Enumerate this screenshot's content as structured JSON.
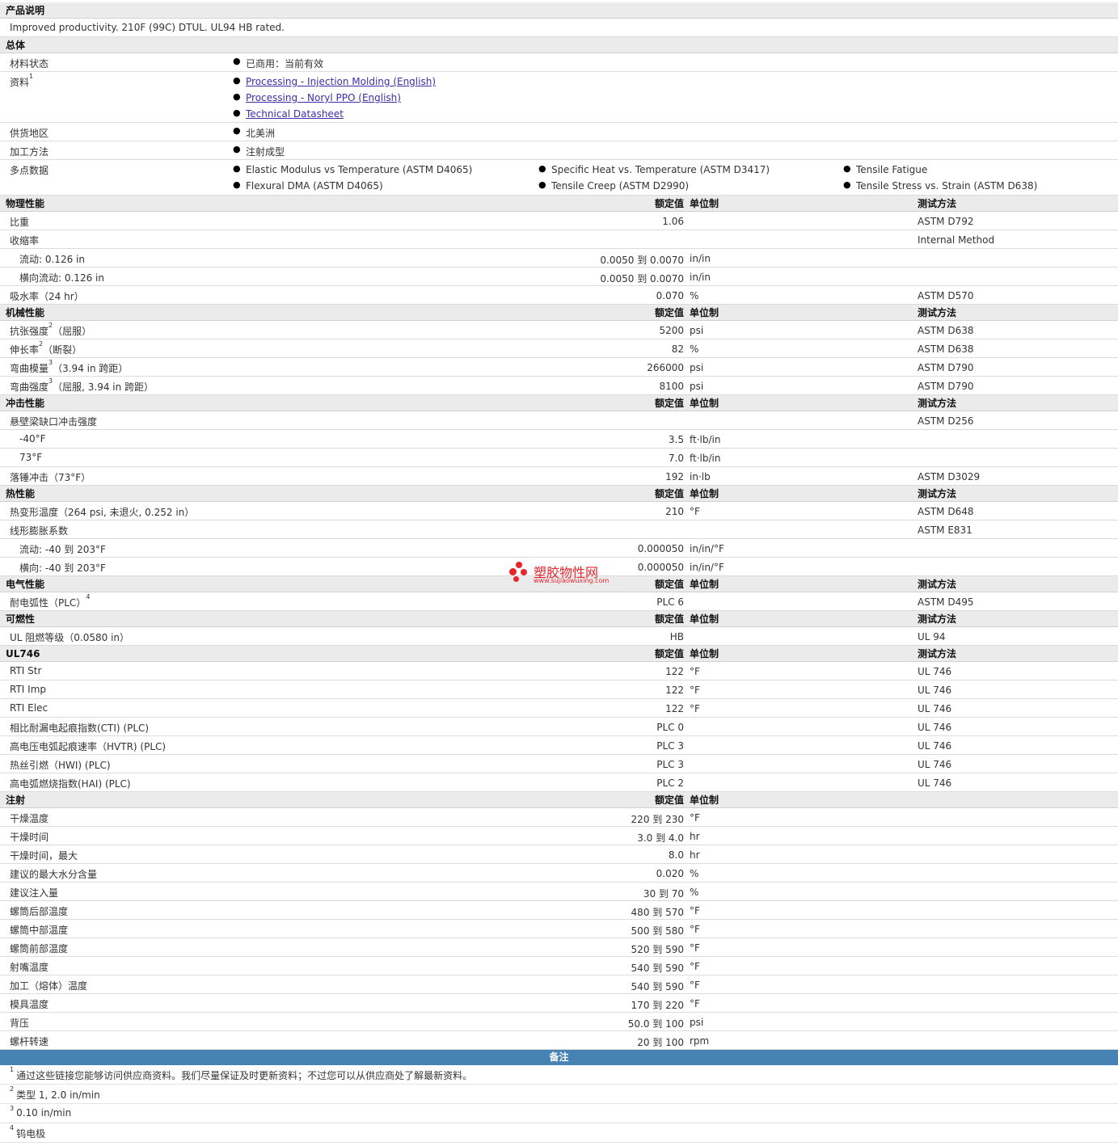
{
  "description": {
    "title": "产品说明",
    "text": "Improved productivity. 210F (99C) DTUL. UL94 HB rated."
  },
  "general": {
    "title": "总体",
    "status_label": "材料状态",
    "status_value": "已商用：当前有效",
    "docs_label": "资料",
    "docs_sup": "1",
    "docs": [
      "Processing - Injection Molding (English)",
      "Processing - Noryl PPO (English)",
      "Technical Datasheet"
    ],
    "region_label": "供货地区",
    "region_value": "北美洲",
    "method_label": "加工方法",
    "method_value": "注射成型",
    "multipoint_label": "多点数据",
    "multipoint": [
      "Elastic Modulus vs Temperature (ASTM D4065)",
      "Specific Heat vs. Temperature (ASTM D3417)",
      "Tensile Fatigue",
      "Flexural DMA (ASTM D4065)",
      "Tensile Creep (ASTM D2990)",
      "Tensile Stress vs. Strain (ASTM D638)"
    ]
  },
  "headers": {
    "value": "额定值",
    "unit": "单位制",
    "method": "测试方法"
  },
  "physical": {
    "title": "物理性能",
    "rows": [
      {
        "l": "比重",
        "v": "1.06",
        "u": "",
        "m": "ASTM D792"
      },
      {
        "l": "收缩率",
        "v": "",
        "u": "",
        "m": "Internal Method"
      },
      {
        "l": "流动: 0.126 in",
        "v": "0.0050 到  0.0070",
        "u": "in/in",
        "m": ""
      },
      {
        "l": "横向流动: 0.126 in",
        "v": "0.0050 到  0.0070",
        "u": "in/in",
        "m": ""
      },
      {
        "l": "吸水率（24 hr）",
        "v": "0.070",
        "u": "%",
        "m": "ASTM D570"
      }
    ]
  },
  "mechanical": {
    "title": "机械性能",
    "rows": [
      {
        "l": "抗张强度",
        "sup": "2",
        "l2": "（屈服）",
        "v": "5200",
        "u": "psi",
        "m": "ASTM D638"
      },
      {
        "l": "伸长率",
        "sup": "2",
        "l2": "（断裂）",
        "v": "82",
        "u": "%",
        "m": "ASTM D638"
      },
      {
        "l": "弯曲模量",
        "sup": "3",
        "l2": "（3.94 in 跨距）",
        "v": "266000",
        "u": "psi",
        "m": "ASTM D790"
      },
      {
        "l": "弯曲强度",
        "sup": "3",
        "l2": "（屈服, 3.94 in 跨距）",
        "v": "8100",
        "u": "psi",
        "m": "ASTM D790"
      }
    ]
  },
  "impact": {
    "title": "冲击性能",
    "rows": [
      {
        "l": "悬壁梁缺口冲击强度",
        "v": "",
        "u": "",
        "m": "ASTM D256"
      },
      {
        "l": "-40°F",
        "v": "3.5",
        "u": "ft·lb/in",
        "m": ""
      },
      {
        "l": "73°F",
        "v": "7.0",
        "u": "ft·lb/in",
        "m": ""
      },
      {
        "l": "落锤冲击（73°F）",
        "v": "192",
        "u": "in·lb",
        "m": "ASTM D3029"
      }
    ]
  },
  "thermal": {
    "title": "热性能",
    "rows": [
      {
        "l": "热变形温度（264 psi, 未退火, 0.252 in）",
        "v": "210",
        "u": "°F",
        "m": "ASTM D648"
      },
      {
        "l": "线形膨胀系数",
        "v": "",
        "u": "",
        "m": "ASTM E831"
      },
      {
        "l": "流动: -40 到  203°F",
        "v": "0.000050",
        "u": "in/in/°F",
        "m": ""
      },
      {
        "l": "横向: -40 到  203°F",
        "v": "0.000050",
        "u": "in/in/°F",
        "m": ""
      }
    ]
  },
  "electrical": {
    "title": "电气性能",
    "rows": [
      {
        "l": "耐电弧性（PLC）",
        "sup": "4",
        "v": "PLC 6",
        "u": "",
        "m": "ASTM D495"
      }
    ]
  },
  "flammability": {
    "title": "可燃性",
    "rows": [
      {
        "l": "UL 阻燃等级（0.0580 in）",
        "v": "HB",
        "u": "",
        "m": "UL 94"
      }
    ]
  },
  "ul746": {
    "title": "UL746",
    "rows": [
      {
        "l": "RTI Str",
        "v": "122",
        "u": "°F",
        "m": "UL 746"
      },
      {
        "l": "RTI Imp",
        "v": "122",
        "u": "°F",
        "m": "UL 746"
      },
      {
        "l": "RTI Elec",
        "v": "122",
        "u": "°F",
        "m": "UL 746"
      },
      {
        "l": "相比耐漏电起痕指数(CTI) (PLC)",
        "v": "PLC 0",
        "u": "",
        "m": "UL 746"
      },
      {
        "l": "高电压电弧起痕速率（HVTR) (PLC)",
        "v": "PLC 3",
        "u": "",
        "m": "UL 746"
      },
      {
        "l": "热丝引燃（HWI) (PLC)",
        "v": "PLC 3",
        "u": "",
        "m": "UL 746"
      },
      {
        "l": "高电弧燃烧指数(HAI) (PLC)",
        "v": "PLC 2",
        "u": "",
        "m": "UL 746"
      }
    ]
  },
  "injection": {
    "title": "注射",
    "rows": [
      {
        "l": "干燥温度",
        "v": "220 到  230",
        "u": "°F"
      },
      {
        "l": "干燥时间",
        "v": "3.0 到  4.0",
        "u": "hr"
      },
      {
        "l": "干燥时间，最大",
        "v": "8.0",
        "u": "hr"
      },
      {
        "l": "建议的最大水分含量",
        "v": "0.020",
        "u": "%"
      },
      {
        "l": "建议注入量",
        "v": "30 到  70",
        "u": "%"
      },
      {
        "l": "螺筒后部温度",
        "v": "480 到  570",
        "u": "°F"
      },
      {
        "l": "螺筒中部温度",
        "v": "500 到  580",
        "u": "°F"
      },
      {
        "l": "螺筒前部温度",
        "v": "520 到  590",
        "u": "°F"
      },
      {
        "l": "射嘴温度",
        "v": "540 到  590",
        "u": "°F"
      },
      {
        "l": "加工（熔体）温度",
        "v": "540 到  590",
        "u": "°F"
      },
      {
        "l": "模具温度",
        "v": "170 到  220",
        "u": "°F"
      },
      {
        "l": "背压",
        "v": "50.0 到  100",
        "u": "psi"
      },
      {
        "l": "螺杆转速",
        "v": "20 到  100",
        "u": "rpm"
      }
    ]
  },
  "notes": {
    "title": "备注",
    "items": [
      {
        "sup": "1",
        "text": "通过这些链接您能够访问供应商资料。我们尽量保证及时更新资料；不过您可以从供应商处了解最新资料。"
      },
      {
        "sup": "2",
        "text": "类型  1, 2.0 in/min"
      },
      {
        "sup": "3",
        "text": "0.10 in/min"
      },
      {
        "sup": "4",
        "text": "钨电极"
      }
    ]
  },
  "watermark": {
    "cn": "塑胶物性网",
    "en": "www.sujiaowuxing.com",
    "color": "#e8242c"
  },
  "colors": {
    "notes_header": "#4682b4",
    "section_bg": "#ebebeb",
    "link": "#3a2fa8"
  }
}
